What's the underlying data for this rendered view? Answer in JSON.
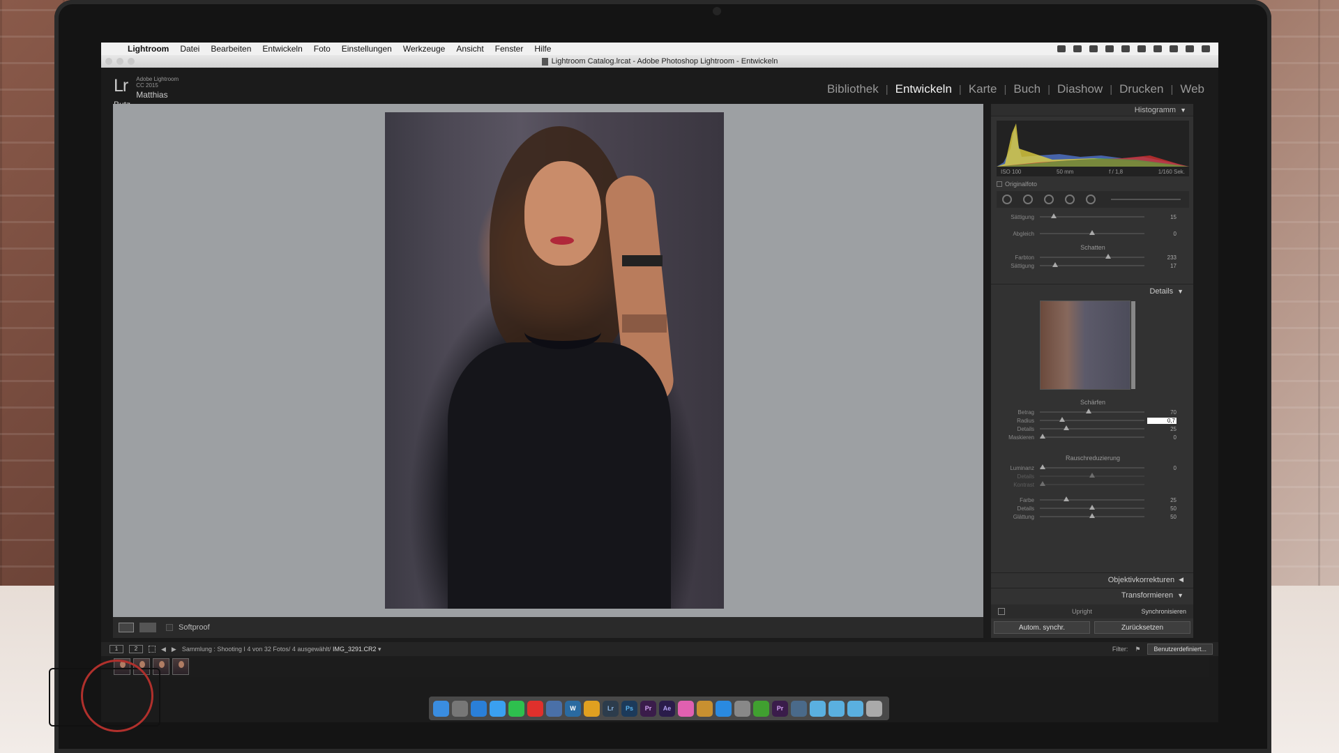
{
  "menubar": {
    "app": "Lightroom",
    "items": [
      "Datei",
      "Bearbeiten",
      "Entwickeln",
      "Foto",
      "Einstellungen",
      "Werkzeuge",
      "Ansicht",
      "Fenster",
      "Hilfe"
    ]
  },
  "window_title": "Lightroom Catalog.lrcat - Adobe Photoshop Lightroom - Entwickeln",
  "identity": {
    "logo": "Lr",
    "product": "Adobe Lightroom CC 2015",
    "user": "Matthias Butz"
  },
  "modules": [
    "Bibliothek",
    "Entwickeln",
    "Karte",
    "Buch",
    "Diashow",
    "Drucken",
    "Web"
  ],
  "active_module": "Entwickeln",
  "toolbar": {
    "softproof": "Softproof"
  },
  "histogram": {
    "title": "Histogramm",
    "iso": "ISO 100",
    "focal": "50 mm",
    "aperture": "f / 1,8",
    "shutter": "1/160 Sek.",
    "original_photo": "Originalfoto"
  },
  "split_toning": {
    "rows1": [
      {
        "label": "Sättigung",
        "value": "15",
        "pos": 0.12
      },
      {
        "label": "Abgleich",
        "value": "0",
        "pos": 0.5
      }
    ],
    "shadows_label": "Schatten",
    "rows2": [
      {
        "label": "Farbton",
        "value": "233",
        "pos": 0.65
      },
      {
        "label": "Sättigung",
        "value": "17",
        "pos": 0.14
      }
    ]
  },
  "details": {
    "title": "Details",
    "sharpen_label": "Schärfen",
    "sharpen": [
      {
        "label": "Betrag",
        "value": "70",
        "pos": 0.47
      },
      {
        "label": "Radius",
        "value": "0,7",
        "pos": 0.2
      },
      {
        "label": "Details",
        "value": "25",
        "pos": 0.25
      },
      {
        "label": "Maskieren",
        "value": "0",
        "pos": 0.0
      }
    ],
    "noise_label": "Rauschreduzierung",
    "noise": [
      {
        "label": "Luminanz",
        "value": "0",
        "pos": 0.0
      },
      {
        "label": "Details",
        "value": "",
        "pos": 0.5
      },
      {
        "label": "Kontrast",
        "value": "",
        "pos": 0.0
      },
      {
        "label": "Farbe",
        "value": "25",
        "pos": 0.25
      },
      {
        "label": "Details",
        "value": "50",
        "pos": 0.5
      },
      {
        "label": "Glättung",
        "value": "50",
        "pos": 0.5
      }
    ]
  },
  "panels": {
    "lens": "Objektivkorrekturen",
    "transform": "Transformieren",
    "upright": "Upright",
    "sync": "Synchronisieren",
    "auto_sync": "Autom. synchr.",
    "reset": "Zurücksetzen"
  },
  "filmstrip": {
    "view1": "1",
    "view2": "2",
    "path": "Sammlung : Shooting I   4 von 32 Fotos/ 4 ausgewählt/",
    "file": "IMG_3291.CR2",
    "filter_label": "Filter:",
    "filter_preset": "Benutzerdefiniert..."
  },
  "dock_icons": [
    {
      "name": "finder-icon",
      "label": "",
      "color": "#3a8de0"
    },
    {
      "name": "launchpad-icon",
      "label": "",
      "color": "#777"
    },
    {
      "name": "safari-icon",
      "label": "",
      "color": "#2a7fd8"
    },
    {
      "name": "messages-icon",
      "label": "",
      "color": "#3aa0f0"
    },
    {
      "name": "whatsapp-icon",
      "label": "",
      "color": "#2ec04e"
    },
    {
      "name": "record-icon",
      "label": "",
      "color": "#e0302c"
    },
    {
      "name": "preview-icon",
      "label": "",
      "color": "#4a70a8"
    },
    {
      "name": "wordpress-icon",
      "label": "W",
      "color": "#2a6aa0"
    },
    {
      "name": "chrome-icon",
      "label": "",
      "color": "#e0a020"
    },
    {
      "name": "lightroom-icon",
      "label": "Lr",
      "color": "#2c3c4c"
    },
    {
      "name": "photoshop-icon",
      "label": "Ps",
      "color": "#1c3a5a"
    },
    {
      "name": "premiere-icon",
      "label": "Pr",
      "color": "#3a1c4a"
    },
    {
      "name": "aftereffects-icon",
      "label": "Ae",
      "color": "#2a1c4a"
    },
    {
      "name": "itunes-icon",
      "label": "",
      "color": "#e060b0"
    },
    {
      "name": "stacks-icon",
      "label": "",
      "color": "#c89030"
    },
    {
      "name": "appstore-icon",
      "label": "",
      "color": "#2a8ae0"
    },
    {
      "name": "settings-icon",
      "label": "",
      "color": "#888"
    },
    {
      "name": "leaf-icon",
      "label": "",
      "color": "#40a030"
    },
    {
      "name": "premiere2-icon",
      "label": "Pr",
      "color": "#3a1c4a"
    },
    {
      "name": "photos-icon",
      "label": "",
      "color": "#4a6a8a"
    },
    {
      "name": "folder-icon",
      "label": "",
      "color": "#5ab0e0"
    },
    {
      "name": "folder2-icon",
      "label": "",
      "color": "#5ab0e0"
    },
    {
      "name": "downloads-icon",
      "label": "",
      "color": "#5ab0e0"
    },
    {
      "name": "trash-icon",
      "label": "",
      "color": "#aaa"
    }
  ]
}
